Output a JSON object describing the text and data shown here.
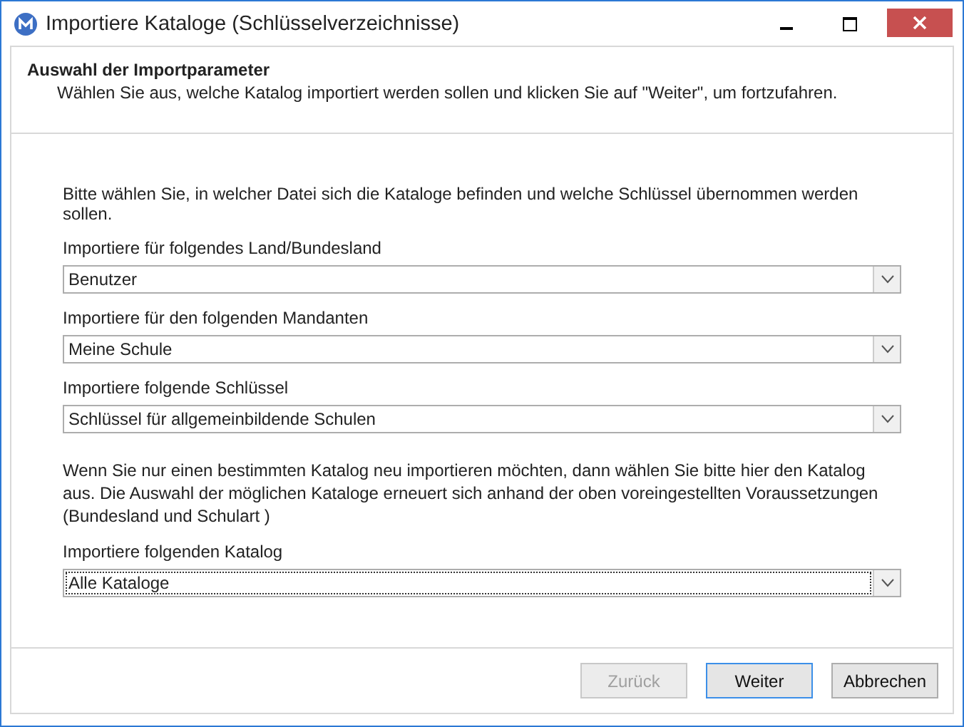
{
  "window": {
    "title": "Importiere Kataloge (Schlüsselverzeichnisse)"
  },
  "header": {
    "title": "Auswahl der Importparameter",
    "subtitle": "Wählen Sie aus, welche Katalog importiert werden sollen und klicken Sie auf \"Weiter\", um fortzufahren."
  },
  "intro": "Bitte wählen Sie, in welcher Datei sich die Kataloge befinden und welche Schlüssel übernommen werden sollen.",
  "fields": [
    {
      "label": "Importiere für folgendes Land/Bundesland",
      "value": "Benutzer",
      "focused": false
    },
    {
      "label": "Importiere für den folgenden Mandanten",
      "value": "Meine Schule",
      "focused": false
    },
    {
      "label": "Importiere folgende Schlüssel",
      "value": "Schlüssel für allgemeinbildende Schulen",
      "focused": false
    }
  ],
  "note": "Wenn Sie nur einen bestimmten Katalog neu importieren möchten, dann wählen Sie bitte hier den Katalog aus. Die Auswahl der möglichen Kataloge erneuert sich anhand der oben voreingestellten Voraussetzungen (Bundesland und Schulart )",
  "catalog_field": {
    "label": "Importiere folgenden Katalog",
    "value": "Alle Kataloge",
    "focused": true
  },
  "buttons": [
    {
      "label": "Zurück",
      "disabled": true,
      "default": false
    },
    {
      "label": "Weiter",
      "disabled": false,
      "default": true
    },
    {
      "label": "Abbrechen",
      "disabled": false,
      "default": false
    }
  ]
}
